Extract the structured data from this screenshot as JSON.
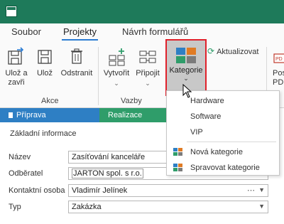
{
  "ribbon_tabs": [
    "Soubor",
    "Projekty",
    "Návrh formulářů"
  ],
  "active_tab_index": 1,
  "toolbar": {
    "save_close": "Ulož a zavři",
    "save": "Ulož",
    "delete": "Odstranit",
    "create": "Vytvořit",
    "attach": "Připojit",
    "category": "Kategorie",
    "refresh": "Aktualizovat",
    "post_partial": "Pos",
    "post_partial2": "PD"
  },
  "groups": {
    "actions": "Akce",
    "links": "Vazby"
  },
  "flow": {
    "step1": "Příprava",
    "step2": "Realizace"
  },
  "form": {
    "section_title": "Základní informace",
    "fields": [
      {
        "label": "Název",
        "value": "Zasíťování kanceláře"
      },
      {
        "label": "Odběratel",
        "value": "JARTON spol. s r.o."
      },
      {
        "label": "Kontaktní osoba",
        "value": "Vladimír Jelínek"
      },
      {
        "label": "Typ",
        "value": "Zakázka"
      }
    ]
  },
  "category_menu": {
    "items": [
      "Hardware",
      "Software",
      "VIP"
    ],
    "actions": [
      "Nová kategorie",
      "Spravovat kategorie"
    ]
  },
  "colors": {
    "titlebar": "#1e7a5a",
    "step1": "#2e7fc4",
    "step2": "#2f9d6a",
    "highlight": "#e0212b",
    "tab_underline": "#2b7cd3"
  }
}
